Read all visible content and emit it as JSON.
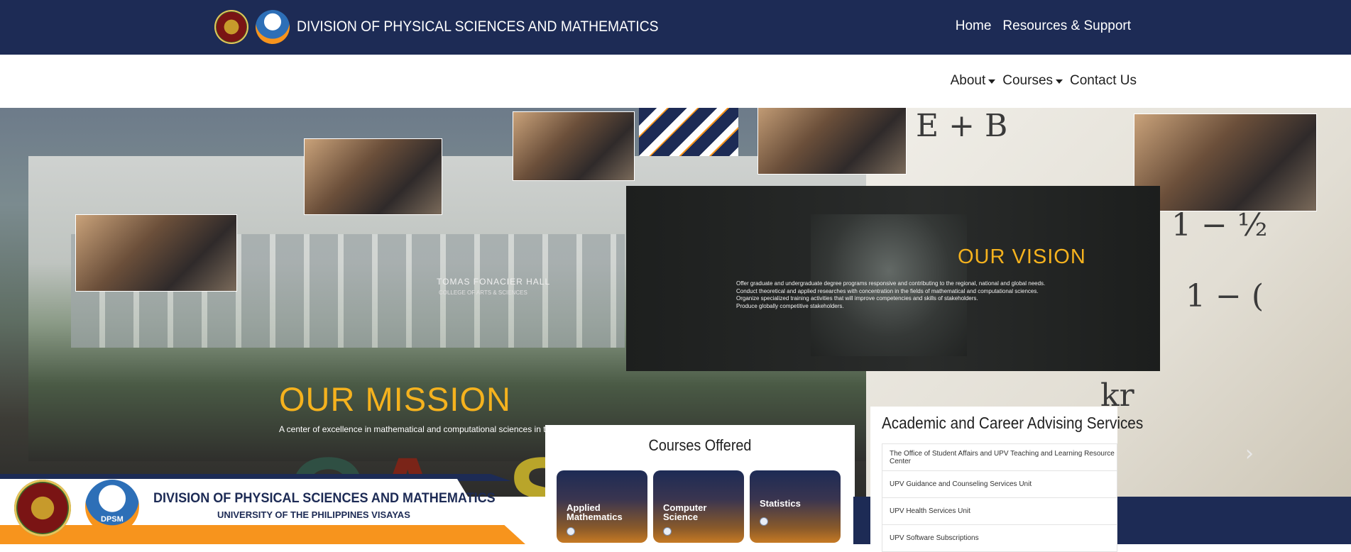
{
  "header": {
    "site_title": "DIVISION OF PHYSICAL SCIENCES AND MATHEMATICS",
    "nav": [
      "Home",
      "Resources & Support"
    ]
  },
  "subnav": {
    "items": [
      {
        "label": "About",
        "dropdown": true
      },
      {
        "label": "Courses",
        "dropdown": true
      },
      {
        "label": "Contact Us",
        "dropdown": false
      }
    ]
  },
  "hero": {
    "mission_title": "OUR MISSION",
    "mission_text": "A center of excellence in mathematical and computational sciences in the Visayas.",
    "vision_title": "OUR VISION",
    "vision_lines": [
      "Offer graduate and undergraduate degree programs responsive and contributing to the regional, national and global needs.",
      "Conduct theoretical and applied researches with concentration in the fields of mathematical and computational sciences.",
      "Organize specialized training activities that will improve competencies and skills of stakeholders.",
      "Produce globally competitive stakeholders."
    ],
    "building_sign": "TOMAS FONACIER HALL",
    "building_sub": "COLLEGE OF ARTS & SCIENCES",
    "cas_letters": [
      "C",
      "A",
      "S"
    ],
    "next_glyph": "›"
  },
  "banner": {
    "title": "DIVISION OF PHYSICAL SCIENCES AND MATHEMATICS",
    "subtitle": "UNIVERSITY OF THE PHILIPPINES VISAYAS",
    "dpsm_text": "DPSM"
  },
  "courses": {
    "title": "Courses Offered",
    "items": [
      "Applied Mathematics",
      "Computer Science",
      "Statistics"
    ]
  },
  "advising": {
    "title": "Academic and Career Advising Services",
    "items": [
      "The Office of Student Affairs and UPV Teaching and Learning Resource Center",
      "UPV Guidance and Counseling Services Unit",
      "UPV Health Services Unit",
      "UPV Software Subscriptions"
    ]
  },
  "colors": {
    "navy": "#1d2b55",
    "gold": "#f5b21e",
    "orange": "#f7941d"
  }
}
